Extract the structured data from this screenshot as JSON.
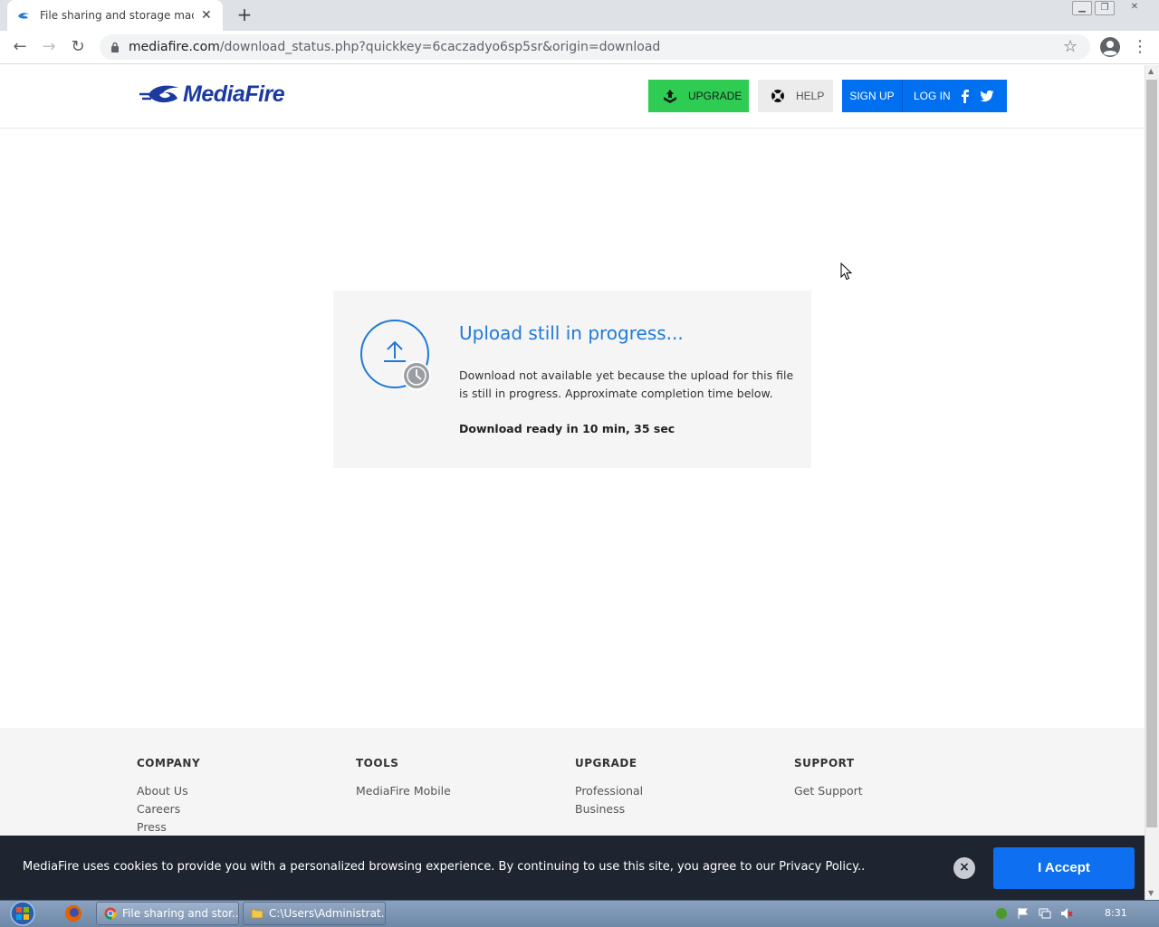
{
  "browser": {
    "tab_title": "File sharing and storage made simple",
    "new_tab_label": "+",
    "url_host": "mediafire.com",
    "url_rest": "/download_status.php?quickkey=6caczadyo6sp5sr&origin=download"
  },
  "header": {
    "logo_text": "MediaFire",
    "upgrade_label": "UPGRADE",
    "help_label": "HELP",
    "signup_label": "SIGN UP",
    "login_label": "LOG IN"
  },
  "status_card": {
    "title": "Upload still in progress...",
    "description": "Download not available yet because the upload for this file is still in progress. Approximate completion time below.",
    "eta": "Download ready in 10 min, 35 sec"
  },
  "footer": {
    "columns": [
      {
        "heading": "COMPANY",
        "links": [
          "About Us",
          "Careers",
          "Press"
        ]
      },
      {
        "heading": "TOOLS",
        "links": [
          "MediaFire Mobile"
        ]
      },
      {
        "heading": "UPGRADE",
        "links": [
          "Professional",
          "Business"
        ]
      },
      {
        "heading": "SUPPORT",
        "links": [
          "Get Support"
        ]
      }
    ]
  },
  "cookie_bar": {
    "text": "MediaFire uses cookies to provide you with a personalized browsing experience. By continuing to use this site, you agree to our Privacy Policy..",
    "close_label": "×",
    "accept_label": "I Accept"
  },
  "taskbar": {
    "chrome_task": "File sharing and stor...",
    "explorer_task": "C:\\Users\\Administrat...",
    "clock": "8:31"
  },
  "colors": {
    "brand_blue": "#1f7ad8",
    "upgrade_green": "#2ecc53",
    "auth_blue": "#0070f0",
    "cookie_bg": "#1e2530"
  }
}
